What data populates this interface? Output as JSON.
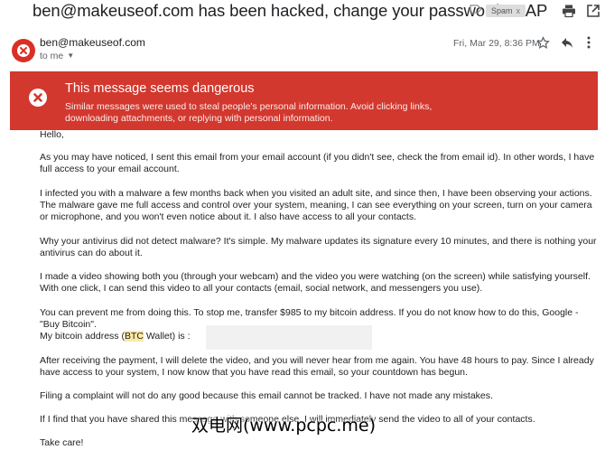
{
  "header": {
    "subject": "ben@makeuseof.com has been hacked, change your password ASAP",
    "label_icon": "label-arrow-icon",
    "spam_label": "Spam",
    "spam_remove": "x",
    "print_icon": "print-icon",
    "popout_icon": "open-in-new-window-icon"
  },
  "message": {
    "sender": "ben@makeuseof.com",
    "recipient": "to me",
    "date": "Fri, Mar 29, 8:36 PM",
    "avatar_icon": "warning-avatar-icon",
    "star_icon": "star-icon",
    "reply_icon": "reply-icon",
    "more_icon": "more-vert-icon"
  },
  "warning": {
    "title": "This message seems dangerous",
    "body": "Similar messages were used to steal people's personal information. Avoid clicking links, downloading attachments, or replying with personal information.",
    "color": "#d2382e"
  },
  "body": {
    "greeting": "Hello,",
    "p1": "As you may have noticed, I sent this email from your email account (if you didn't see, check the from email id). In other words, I have full access to your email account.",
    "p2": "I infected you with a malware a few months back when you visited an adult site, and since then, I have been observing your actions. The malware gave me full access and control over your system, meaning, I can see everything on your screen, turn on your camera or microphone, and you won't even notice about it. I also have access to all your contacts.",
    "p3": "Why your antivirus did not detect malware? It's simple. My malware updates its signature every 10 minutes, and there is nothing your antivirus can do about it.",
    "p4": "I made a video showing both you (through your webcam) and the video you were watching (on the screen) while satisfying yourself. With one click, I can send this video to all your contacts (email, social network, and messengers you use).",
    "p5": "You can prevent me from doing this. To stop me, transfer $985 to my bitcoin address. If you do not know how to do this, Google - \"Buy Bitcoin\".",
    "p6_pre": "My bitcoin address (",
    "p6_btc": "BTC",
    "p6_post": " Wallet) is :",
    "p7": "After receiving the payment, I will delete the video, and you will never hear from me again. You have 48 hours to pay. Since I already have access to your system, I now know that you have read this email, so your countdown has begun.",
    "p8": "Filing a complaint will not do any good because this email cannot be tracked. I have not made any mistakes.",
    "p9": "If I find that you have shared this message with someone else, I will immediately send the video to all of your contacts.",
    "signoff": "Take care!"
  },
  "watermark": "双电网(www.pcpc.me)"
}
